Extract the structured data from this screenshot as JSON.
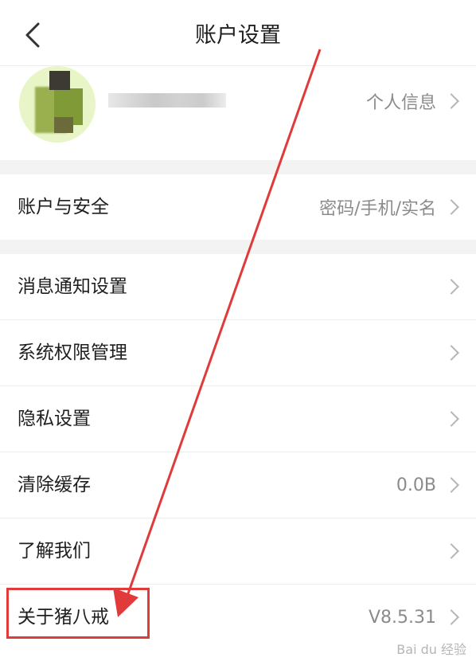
{
  "header": {
    "title": "账户设置"
  },
  "profile": {
    "right_label": "个人信息"
  },
  "rows": [
    {
      "label": "账户与安全",
      "value": "密码/手机/实名"
    },
    {
      "label": "消息通知设置",
      "value": ""
    },
    {
      "label": "系统权限管理",
      "value": ""
    },
    {
      "label": "隐私设置",
      "value": ""
    },
    {
      "label": "清除缓存",
      "value": "0.0B"
    },
    {
      "label": "了解我们",
      "value": ""
    },
    {
      "label": "关于猪八戒",
      "value": "V8.5.31"
    }
  ],
  "watermark": "Bai du 经验",
  "colors": {
    "highlight": "#e03a3a",
    "gap": "#f3f3f3",
    "secondary_text": "#8b8b8b"
  }
}
